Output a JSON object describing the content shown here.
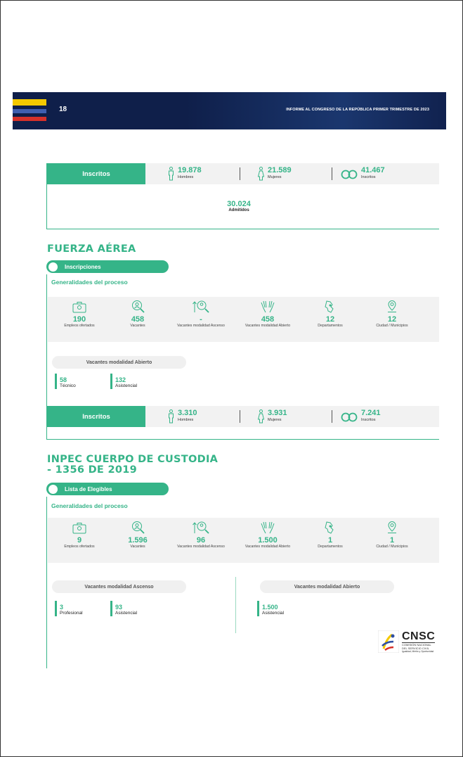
{
  "header": {
    "page_number": "18",
    "report_title": "INFORME AL CONGRESO DE LA REPÚBLICA PRIMER TRIMESTRE DE 2023",
    "colors": {
      "band": "#0f1f4a",
      "flag_yellow": "#f4c900",
      "flag_blue": "#3f5fb0",
      "flag_red": "#d6312a"
    }
  },
  "accent_color": "#35b488",
  "top_section": {
    "inscritos": {
      "label": "Inscritos",
      "hombres": {
        "value": "19.878",
        "label": "Hombres"
      },
      "mujeres": {
        "value": "21.589",
        "label": "Mujeres"
      },
      "total": {
        "value": "41.467",
        "label": "Inscritos"
      }
    },
    "admitidos": {
      "value": "30.024",
      "label": "Admitidos"
    }
  },
  "fuerza_aerea": {
    "title": "FUERZA AÉREA",
    "stage_pill": "Inscripciones",
    "generalidades_title": "Generalidades del proceso",
    "generalidades": [
      {
        "icon": "briefcase-icon",
        "value": "190",
        "label": "Empleos ofertados"
      },
      {
        "icon": "magnifier-user-icon",
        "value": "458",
        "label": "Vacantes"
      },
      {
        "icon": "ascend-search-icon",
        "value": "-",
        "label": "Vacantes modalidad Ascenso"
      },
      {
        "icon": "open-hands-icon",
        "value": "458",
        "label": "Vacantes modalidad Abierto"
      },
      {
        "icon": "map-region-icon",
        "value": "12",
        "label": "Departamentos"
      },
      {
        "icon": "location-pin-icon",
        "value": "12",
        "label": "Ciudad / Municipios"
      }
    ],
    "vacantes_abierto": {
      "title": "Vacantes modalidad Abierto",
      "items": [
        {
          "value": "58",
          "label": "Técnico"
        },
        {
          "value": "132",
          "label": "Asistencial"
        }
      ]
    },
    "inscritos": {
      "label": "Inscritos",
      "hombres": {
        "value": "3.310",
        "label": "Hombres"
      },
      "mujeres": {
        "value": "3.931",
        "label": "Mujeres"
      },
      "total": {
        "value": "7.241",
        "label": "Inscritos"
      }
    }
  },
  "inpec": {
    "title_line1": "INPEC CUERPO DE CUSTODIA",
    "title_line2": "- 1356 DE 2019",
    "stage_pill": "Lista de Elegibles",
    "generalidades_title": "Generalidades del proceso",
    "generalidades": [
      {
        "icon": "briefcase-icon",
        "value": "9",
        "label": "Empleos ofertados"
      },
      {
        "icon": "magnifier-user-icon",
        "value": "1.596",
        "label": "Vacantes"
      },
      {
        "icon": "ascend-search-icon",
        "value": "96",
        "label": "Vacantes modalidad Ascenso"
      },
      {
        "icon": "open-hands-icon",
        "value": "1.500",
        "label": "Vacantes modalidad Abierto"
      },
      {
        "icon": "map-region-icon",
        "value": "1",
        "label": "Departamentos"
      },
      {
        "icon": "location-pin-icon",
        "value": "1",
        "label": "Ciudad / Municipios"
      }
    ],
    "vacantes_ascenso": {
      "title": "Vacantes modalidad Ascenso",
      "items": [
        {
          "value": "3",
          "label": "Profesional"
        },
        {
          "value": "93",
          "label": "Asistencial"
        }
      ]
    },
    "vacantes_abierto": {
      "title": "Vacantes modalidad Abierto",
      "items": [
        {
          "value": "1.500",
          "label": "Asistencial"
        }
      ]
    }
  },
  "logo": {
    "name": "CNSC",
    "line1": "COMISIÓN NACIONAL",
    "line2": "DEL SERVICIO CIVIL",
    "tagline": "Igualdad, Mérito y Oportunidad"
  }
}
